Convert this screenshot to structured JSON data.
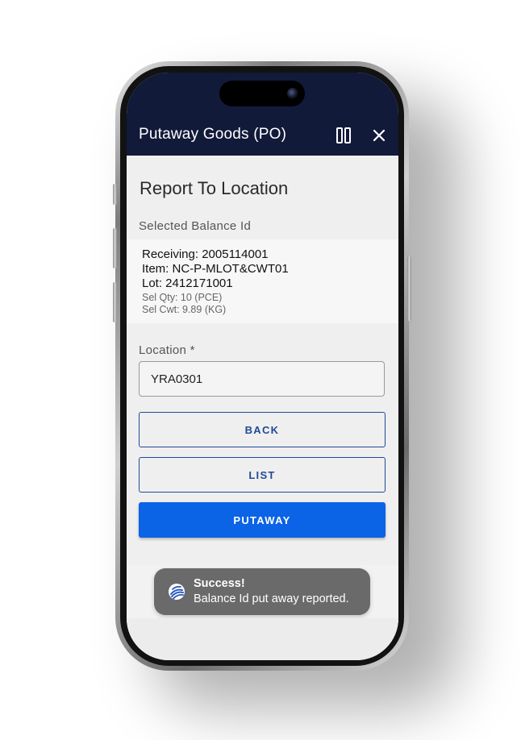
{
  "app_bar": {
    "title": "Putaway Goods (PO)",
    "background": "#121a3a",
    "pause_icon": "pause-icon",
    "close_icon": "close-icon"
  },
  "page": {
    "section_title": "Report To Location",
    "balance_heading": "Selected Balance Id"
  },
  "balance": {
    "receiving": "Receiving: 2005114001",
    "item": "Item: NC-P-MLOT&CWT01",
    "lot": "Lot: 2412171001",
    "sel_qty": "Sel Qty: 10 (PCE)",
    "sel_cwt": "Sel Cwt: 9.89 (KG)"
  },
  "location": {
    "label": "Location *",
    "value": "YRA0301"
  },
  "buttons": {
    "back": "BACK",
    "list": "LIST",
    "putaway": "PUTAWAY",
    "primary_color": "#0b63e6",
    "outline_color": "#1f4a96"
  },
  "toast": {
    "title": "Success!",
    "message": "Balance Id put away reported.",
    "icon": "app-logo-icon"
  }
}
